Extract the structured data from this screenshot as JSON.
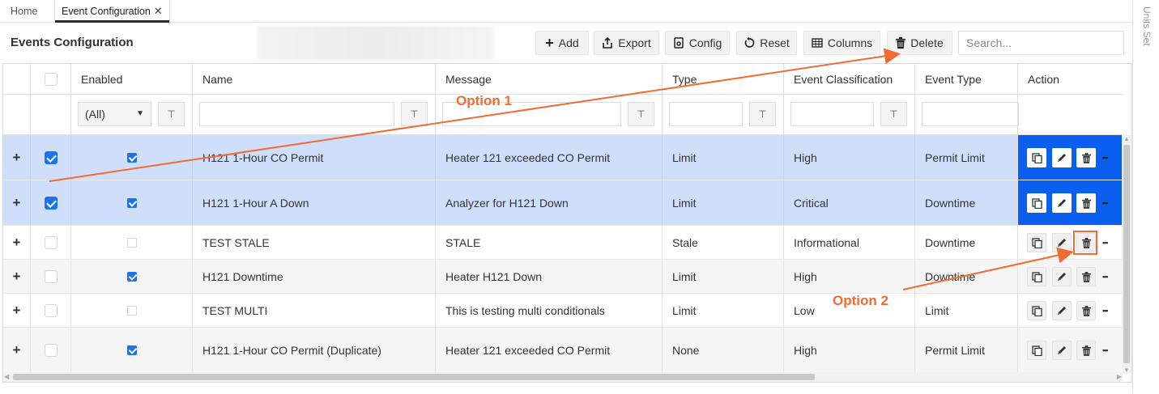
{
  "tabs": [
    {
      "label": "Home"
    },
    {
      "label": "Event Configuration",
      "close": "✕"
    }
  ],
  "units_panel": {
    "label": "Units Set"
  },
  "page": {
    "title": "Events Configuration"
  },
  "toolbar": {
    "add": "Add",
    "export": "Export",
    "config": "Config",
    "reset": "Reset",
    "columns": "Columns",
    "delete": "Delete",
    "search_placeholder": "Search..."
  },
  "columns": [
    "Enabled",
    "Name",
    "Message",
    "Type",
    "Event Classification",
    "Event Type",
    "Action"
  ],
  "filters": {
    "enabled_value": "(All)"
  },
  "rows": [
    {
      "selected": true,
      "enabled": true,
      "name": "H121 1-Hour CO Permit",
      "message": "Heater 121 exceeded CO Permit",
      "type": "Limit",
      "classification": "High",
      "event_type": "Permit Limit"
    },
    {
      "selected": true,
      "enabled": true,
      "name": "H121 1-Hour A Down",
      "message": "Analyzer for H121 Down",
      "type": "Limit",
      "classification": "Critical",
      "event_type": "Downtime"
    },
    {
      "selected": false,
      "enabled": false,
      "name": "TEST STALE",
      "message": "STALE",
      "type": "Stale",
      "classification": "Informational",
      "event_type": "Downtime"
    },
    {
      "selected": false,
      "enabled": true,
      "name": "H121 Downtime",
      "message": "Heater H121 Down",
      "type": "Limit",
      "classification": "High",
      "event_type": "Downtime"
    },
    {
      "selected": false,
      "enabled": false,
      "name": "TEST MULTI",
      "message": "This is testing multi conditionals",
      "type": "Limit",
      "classification": "Low",
      "event_type": "Limit"
    },
    {
      "selected": false,
      "enabled": true,
      "name": "H121 1-Hour CO Permit (Duplicate)",
      "message": "Heater 121 exceeded CO Permit",
      "type": "None",
      "classification": "High",
      "event_type": "Permit Limit"
    }
  ],
  "annotations": {
    "option1": "Option 1",
    "option2": "Option 2"
  },
  "colors": {
    "selected_row": "#cfdffb",
    "action_selected": "#0a5ef0",
    "annotation": "#f26b32",
    "checkbox": "#1a73e8"
  }
}
